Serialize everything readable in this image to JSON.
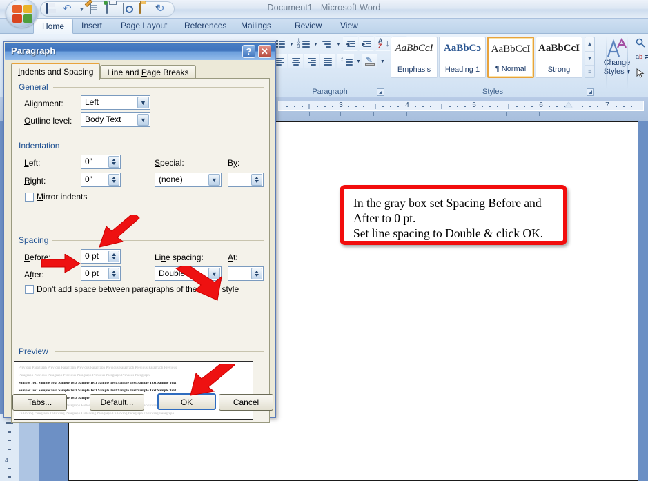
{
  "window": {
    "title": "Document1 - Microsoft Word",
    "office_button": "office-orb"
  },
  "quick_access": {
    "items": [
      {
        "name": "save-icon",
        "tooltip": "Save"
      },
      {
        "name": "undo-icon",
        "tooltip": "Undo"
      },
      {
        "name": "undo-dropdown-icon",
        "tooltip": "Undo options"
      },
      {
        "name": "new-document-icon",
        "tooltip": "New"
      },
      {
        "name": "print-icon",
        "tooltip": "Quick Print"
      },
      {
        "name": "print-preview-icon",
        "tooltip": "Print Preview"
      },
      {
        "name": "open-icon",
        "tooltip": "Open"
      },
      {
        "name": "redo-icon",
        "tooltip": "Redo"
      }
    ],
    "customize_label": "▾"
  },
  "ribbon": {
    "tabs": [
      {
        "label": "Home",
        "active": true
      },
      {
        "label": "Insert",
        "active": false
      },
      {
        "label": "Page Layout",
        "active": false
      },
      {
        "label": "References",
        "active": false
      },
      {
        "label": "Mailings",
        "active": false
      },
      {
        "label": "Review",
        "active": false
      },
      {
        "label": "View",
        "active": false
      }
    ],
    "groups": [
      {
        "label": "Paragraph"
      },
      {
        "label": "Styles"
      }
    ],
    "paragraph_buttons": [
      "bullets-icon",
      "numbering-icon",
      "multilevel-list-icon",
      "decrease-indent-icon",
      "increase-indent-icon",
      "sort-icon",
      "show-formatting-marks-icon",
      "align-left-icon",
      "align-center-icon",
      "align-right-icon",
      "justify-icon",
      "line-spacing-icon",
      "shading-icon",
      "borders-icon"
    ],
    "styles": {
      "gallery": [
        {
          "sample": "AaBbCcI",
          "name": "Emphasis",
          "selected": false
        },
        {
          "sample": "AaBbCɔ",
          "name": "Heading 1",
          "selected": false
        },
        {
          "sample": "AaBbCcI",
          "name": "¶ Normal",
          "selected": true
        },
        {
          "sample": "AaBbCcI",
          "name": "Strong",
          "selected": false
        }
      ],
      "scroll_up": "▲",
      "scroll_down": "▼",
      "scroll_more": "≡",
      "change_styles_line1": "Change",
      "change_styles_line2": "Styles ▾"
    },
    "editing": [
      {
        "name": "find-icon",
        "label": "Find"
      },
      {
        "name": "replace-icon",
        "label": "Replace"
      },
      {
        "name": "select-icon",
        "label": "Select"
      }
    ]
  },
  "ruler": {
    "numbers": [
      "3",
      "4",
      "5",
      "6",
      "7"
    ],
    "indent_marker": "left-indent-marker"
  },
  "dialog": {
    "title": "Paragraph",
    "help_label": "?",
    "close_label": "✕",
    "tabs": [
      {
        "label": "Indents and Spacing",
        "active": true
      },
      {
        "label": "Line and Page Breaks",
        "active": false
      }
    ],
    "general": {
      "section": "General",
      "alignment_label": "Alignment:",
      "alignment_value": "Left",
      "outline_label": "Outline level:",
      "outline_value": "Body Text"
    },
    "indentation": {
      "section": "Indentation",
      "left_label": "Left:",
      "left_value": "0\"",
      "right_label": "Right:",
      "right_value": "0\"",
      "special_label": "Special:",
      "special_value": "(none)",
      "by_label": "By:",
      "by_value": "",
      "mirror_label": "Mirror indents",
      "mirror_checked": false
    },
    "spacing": {
      "section": "Spacing",
      "before_label": "Before:",
      "before_value": "0 pt",
      "after_label": "After:",
      "after_value": "0 pt",
      "line_spacing_label": "Line spacing:",
      "line_spacing_value": "Double",
      "at_label": "At:",
      "at_value": "",
      "dont_add_label": "Don't add space between paragraphs of the same style",
      "dont_add_checked": false
    },
    "preview": {
      "section": "Preview",
      "lines": [
        {
          "style": "gray",
          "text": "Previous Paragraph Previous Paragraph Previous Paragraph Previous Paragraph Previous Paragraph Previous"
        },
        {
          "style": "gray",
          "text": "Paragraph Previous Paragraph Previous Paragraph Previous Paragraph Previous Paragraph"
        },
        {
          "style": "bold",
          "text": "Sample Text Sample Text Sample Text Sample Text Sample Text Sample Text Sample Text Sample Text"
        },
        {
          "style": "bold",
          "text": "Sample Text Sample Text Sample Text Sample Text Sample Text Sample Text Sample Text Sample Text"
        },
        {
          "style": "bold",
          "text": "Sample Text Sample Text Sample Text Sample Text Sample Text"
        },
        {
          "style": "gray",
          "text": "Following Paragraph Following Paragraph Following Paragraph Following Paragraph Following Paragraph"
        },
        {
          "style": "gray",
          "text": "Following Paragraph Following Paragraph Following Paragraph Following Paragraph Following Paragraph"
        }
      ]
    },
    "buttons": {
      "tabs": "Tabs...",
      "default": "Default...",
      "ok": "OK",
      "cancel": "Cancel"
    }
  },
  "callout": {
    "line1": "In the gray box set Spacing Before and",
    "line2": "After to 0 pt.",
    "line3": "Set line spacing to Double & click OK.",
    "border_color": "#f20d0d"
  },
  "annotations": {
    "arrow_color": "#ee1111",
    "arrows": [
      {
        "name": "arrow-to-spacing-before",
        "target": "Before spin box"
      },
      {
        "name": "arrow-to-spacing-after",
        "target": "After spin box"
      },
      {
        "name": "arrow-to-line-spacing",
        "target": "Line spacing combo"
      },
      {
        "name": "arrow-to-ok-button",
        "target": "OK button"
      }
    ]
  },
  "colors": {
    "accent_blue": "#3f74bd",
    "dialog_face": "#ece9d8",
    "panel_face": "#f4f2ea",
    "doc_background": "#6b8fc4",
    "red": "#ee1111"
  }
}
